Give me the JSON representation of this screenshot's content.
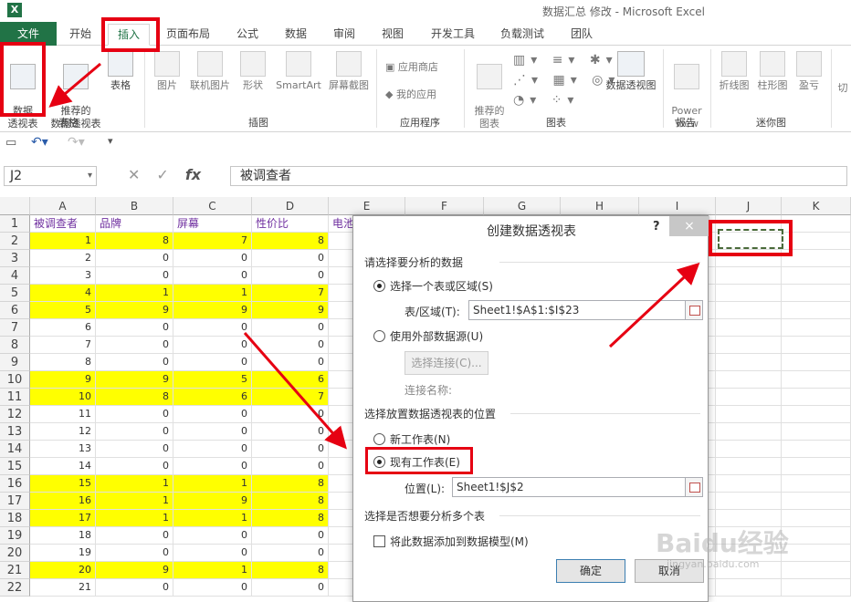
{
  "window": {
    "title": "数据汇总 修改 - Microsoft Excel",
    "app_icon": "X"
  },
  "tabs": [
    "文件",
    "开始",
    "插入",
    "页面布局",
    "公式",
    "数据",
    "审阅",
    "视图",
    "开发工具",
    "负载测试",
    "团队"
  ],
  "ribbon": {
    "pivot_table": "数据\n透视表",
    "recommended_pivot": "推荐的\n数据透视表",
    "table": "表格",
    "group_tables": "表格",
    "picture": "图片",
    "online_picture": "联机图片",
    "shapes": "形状",
    "smartart": "SmartArt",
    "screenshot": "屏幕截图",
    "group_illustrations": "插图",
    "app_store": "应用商店",
    "my_apps": "我的应用",
    "group_apps": "应用程序",
    "recommended_charts": "推荐的\n图表",
    "pivot_chart": "数据透视图",
    "group_charts": "图表",
    "power_view": "Power\nView",
    "group_reports": "报告",
    "line": "折线图",
    "column": "柱形图",
    "win_loss": "盈亏",
    "slicer": "切",
    "group_sparklines": "迷你图"
  },
  "formula_bar": {
    "name_box": "J2",
    "fx": "fx",
    "value": "被调查者"
  },
  "columns": [
    "A",
    "B",
    "C",
    "D",
    "E",
    "F",
    "G",
    "H",
    "I",
    "J",
    "K"
  ],
  "rows": [
    "1",
    "2",
    "3",
    "4",
    "5",
    "6",
    "7",
    "8",
    "9",
    "10",
    "11",
    "12",
    "13",
    "14",
    "15",
    "16",
    "17",
    "18",
    "19",
    "20",
    "21",
    "22"
  ],
  "headers": [
    "被调查者",
    "品牌",
    "屏幕",
    "性价比",
    "电池"
  ],
  "data": [
    [
      1,
      8,
      7,
      8
    ],
    [
      2,
      0,
      0,
      0
    ],
    [
      3,
      0,
      0,
      0
    ],
    [
      4,
      1,
      1,
      7
    ],
    [
      5,
      9,
      9,
      9
    ],
    [
      6,
      0,
      0,
      0
    ],
    [
      7,
      0,
      0,
      0
    ],
    [
      8,
      0,
      0,
      0
    ],
    [
      9,
      9,
      5,
      6
    ],
    [
      10,
      8,
      6,
      7
    ],
    [
      11,
      0,
      0,
      0
    ],
    [
      12,
      0,
      0,
      0
    ],
    [
      13,
      0,
      0,
      0
    ],
    [
      14,
      0,
      0,
      0
    ],
    [
      15,
      1,
      1,
      8
    ],
    [
      16,
      1,
      9,
      8
    ],
    [
      17,
      1,
      1,
      8
    ],
    [
      18,
      0,
      0,
      0
    ],
    [
      19,
      0,
      0,
      0
    ],
    [
      20,
      9,
      1,
      8
    ],
    [
      21,
      0,
      0,
      0
    ]
  ],
  "highlight_color": "#ffff00",
  "dialog": {
    "title": "创建数据透视表",
    "help": "?",
    "close": "×",
    "section1": "请选择要分析的数据",
    "option_select_range": "选择一个表或区域(S)",
    "range_label": "表/区域(T):",
    "range_value": "Sheet1!$A$1:$I$23",
    "option_external": "使用外部数据源(U)",
    "choose_connection": "选择连接(C)...",
    "connection_name": "连接名称:",
    "section2": "选择放置数据透视表的位置",
    "option_new_sheet": "新工作表(N)",
    "option_existing_sheet": "现有工作表(E)",
    "location_label": "位置(L):",
    "location_value": "Sheet1!$J$2",
    "section3": "选择是否想要分析多个表",
    "add_to_model": "将此数据添加到数据模型(M)",
    "ok": "确定",
    "cancel": "取消"
  },
  "watermark": {
    "text": "Baidu经验",
    "url": "jingyan.baidu.com"
  },
  "accent_color": "#217346",
  "annotation_color": "#e60012"
}
